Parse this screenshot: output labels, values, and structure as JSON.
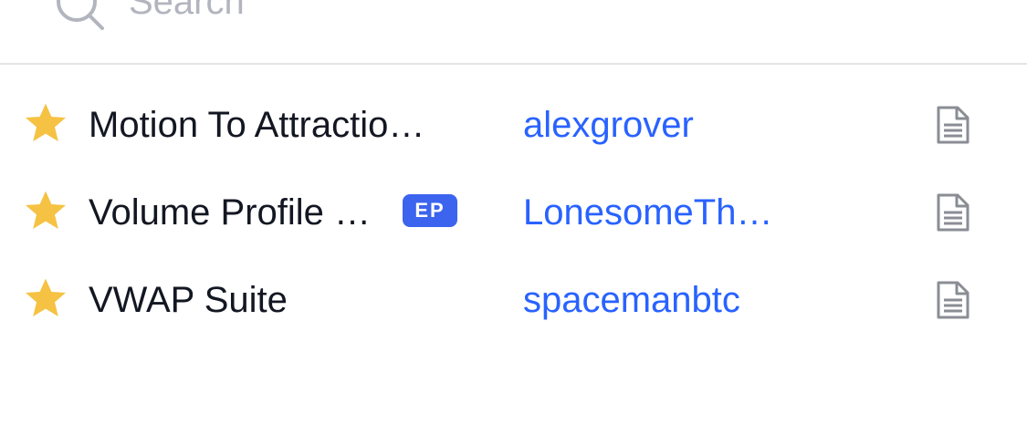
{
  "search": {
    "placeholder": "Search"
  },
  "rows": [
    {
      "title": "Motion To Attractio…",
      "badge": "",
      "author": "alexgrover",
      "favorite": true,
      "icon": "document-icon"
    },
    {
      "title": "Volume Profile …",
      "badge": "EP",
      "author": "LonesomeTh…",
      "favorite": true,
      "icon": "document-icon"
    },
    {
      "title": "VWAP Suite",
      "badge": "",
      "author": "spacemanbtc",
      "favorite": true,
      "icon": "document-icon"
    }
  ],
  "colors": {
    "star": "#f5c243",
    "link": "#2962ff",
    "badge_bg": "#3c64ee",
    "text": "#131722",
    "placeholder": "#b2b5be",
    "icon_gray": "#8a8d94",
    "divider": "#e3e4e8"
  }
}
